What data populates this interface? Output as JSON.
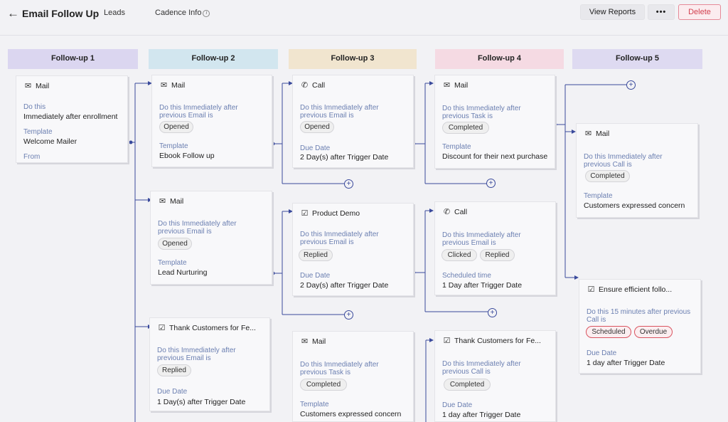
{
  "header": {
    "back_icon": "←",
    "title": "Email Follow Up",
    "tab_leads": "Leads",
    "tab_cadence": "Cadence Info",
    "info_icon": "i",
    "view_reports": "View Reports",
    "more": "•••",
    "delete": "Delete"
  },
  "columns": [
    {
      "label": "Follow-up 1",
      "color": "#dbd6f0"
    },
    {
      "label": "Follow-up 2",
      "color": "#d2e6ef"
    },
    {
      "label": "Follow-up 3",
      "color": "#f1e5cf"
    },
    {
      "label": "Follow-up 4",
      "color": "#f5dae3"
    },
    {
      "label": "Follow-up 5",
      "color": "#dedaf1"
    }
  ],
  "cards": {
    "c1": {
      "icon": "mail-icon",
      "title": "Mail",
      "lbl1": "Do this",
      "val1": "Immediately after enrollment",
      "lbl2": "Template",
      "val2": "Welcome Mailer",
      "lbl3": "From"
    },
    "c2a": {
      "icon": "mail-icon",
      "title": "Mail",
      "lbl1": "Do this Immediately after previous Email is",
      "pills": [
        "Opened"
      ],
      "lbl2": "Template",
      "val2": "Ebook Follow up"
    },
    "c2b": {
      "icon": "mail-icon",
      "title": "Mail",
      "lbl1": "Do this Immediately after previous Email is",
      "pills": [
        "Opened"
      ],
      "lbl2": "Template",
      "val2": "Lead Nurturing"
    },
    "c2c": {
      "icon": "checkbox-icon",
      "title": "Thank Customers for Fe...",
      "lbl1": "Do this Immediately after previous Email is",
      "pills": [
        "Replied"
      ],
      "lbl2": "Due Date",
      "val2": "1 Day(s) after Trigger Date"
    },
    "c3a": {
      "icon": "phone-icon",
      "title": "Call",
      "lbl1": "Do this Immediately after previous Email is",
      "pills": [
        "Opened"
      ],
      "lbl2": "Due Date",
      "val2": "2 Day(s) after Trigger Date"
    },
    "c3b": {
      "icon": "checkbox-icon",
      "title": "Product Demo",
      "lbl1": "Do this Immediately after previous Email is",
      "pills": [
        "Replied"
      ],
      "lbl2": "Due Date",
      "val2": "2 Day(s) after Trigger Date"
    },
    "c3c": {
      "icon": "mail-icon",
      "title": "Mail",
      "lbl1": "Do this Immediately after previous Task is",
      "pills": [
        "Completed"
      ],
      "lbl2": "Template",
      "val2": "Customers expressed concern"
    },
    "c4a": {
      "icon": "mail-icon",
      "title": "Mail",
      "lbl1": "Do this Immediately after previous Task is",
      "pills": [
        "Completed"
      ],
      "lbl2": "Template",
      "val2": "Discount for their next purchase"
    },
    "c4b": {
      "icon": "phone-icon",
      "title": "Call",
      "lbl1": "Do this Immediately after previous Email is",
      "pills": [
        "Clicked",
        "Replied"
      ],
      "lbl2": "Scheduled time",
      "val2": "1 Day after Trigger Date"
    },
    "c4c": {
      "icon": "checkbox-icon",
      "title": "Thank Customers for Fe...",
      "lbl1": "Do this Immediately after previous Call is",
      "pills": [
        "Completed"
      ],
      "lbl2": "Due Date",
      "val2": "1 day after Trigger Date"
    },
    "c5a": {
      "icon": "mail-icon",
      "title": "Mail",
      "lbl1": "Do this Immediately after previous Call is",
      "pills": [
        "Completed"
      ],
      "lbl2": "Template",
      "val2": "Customers expressed concern"
    },
    "c5b": {
      "icon": "checkbox-icon",
      "title": "Ensure efficient follo...",
      "lbl1": "Do this 15 minutes after previous Call is",
      "pills": [
        "Scheduled",
        "Overdue"
      ],
      "lbl2": "Due Date",
      "val2": "1 day after Trigger Date"
    }
  },
  "add_icon": "+",
  "colors": {
    "connector": "#3a4a9c",
    "label": "#6b7fb1",
    "delete": "#d2404f"
  }
}
